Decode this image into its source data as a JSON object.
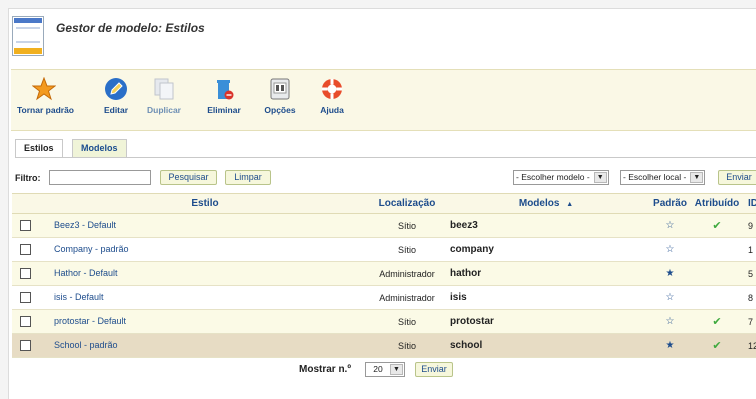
{
  "header": {
    "title": "Gestor de modelo: Estilos"
  },
  "toolbar": {
    "make_default": "Tornar padrão",
    "edit": "Editar",
    "duplicate": "Duplicar",
    "delete": "Eliminar",
    "options": "Opções",
    "help": "Ajuda"
  },
  "tabs": [
    {
      "label": "Estilos"
    },
    {
      "label": "Modelos"
    }
  ],
  "filter": {
    "label": "Filtro:",
    "value": "",
    "search_label": "Pesquisar",
    "clear_label": "Limpar",
    "template_select": "- Escolher modelo -",
    "location_select": "- Escolher local -",
    "submit_label": "Enviar"
  },
  "table": {
    "headers": {
      "style": "Estilo",
      "location": "Localização",
      "templates": "Modelos",
      "sort_indicator": "▲",
      "default": "Padrão",
      "assigned": "Atribuído",
      "id": "ID"
    },
    "rows": [
      {
        "style": "Beez3 - Default",
        "location": "Sítio",
        "template": "beez3",
        "default": false,
        "assigned": true,
        "id": "9"
      },
      {
        "style": "Company - padrão",
        "location": "Sítio",
        "template": "company",
        "default": false,
        "assigned": false,
        "id": "1"
      },
      {
        "style": "Hathor - Default",
        "location": "Administrador",
        "template": "hathor",
        "default": true,
        "assigned": false,
        "id": "5"
      },
      {
        "style": "isis - Default",
        "location": "Administrador",
        "template": "isis",
        "default": false,
        "assigned": false,
        "id": "8"
      },
      {
        "style": "protostar - Default",
        "location": "Sítio",
        "template": "protostar",
        "default": false,
        "assigned": true,
        "id": "7"
      },
      {
        "style": "School - padrão",
        "location": "Sítio",
        "template": "school",
        "default": true,
        "assigned": true,
        "id": "12"
      }
    ]
  },
  "pagination": {
    "label": "Mostrar n.º",
    "limit": "20",
    "submit_label": "Enviar"
  },
  "colors": {
    "accent": "#1d4c8c",
    "toolbar_bg": "#faf8e6",
    "selected_row": "#e7dcc4",
    "tick": "#3ea93e"
  }
}
